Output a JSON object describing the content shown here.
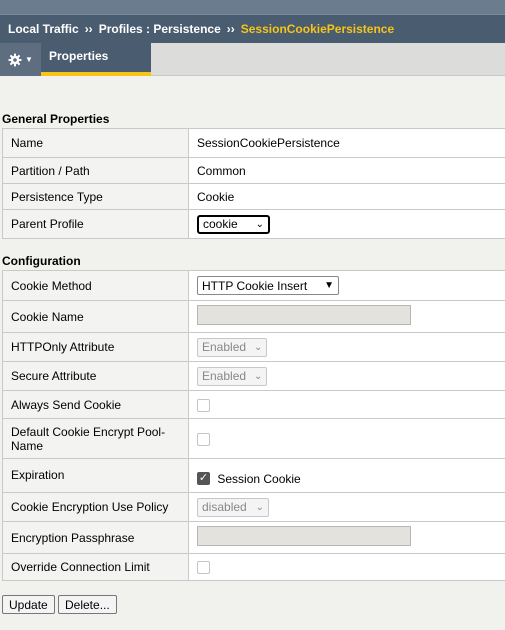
{
  "breadcrumb": {
    "items": [
      "Local Traffic",
      "Profiles : Persistence"
    ],
    "separator": "››",
    "current": "SessionCookiePersistence"
  },
  "tabs": {
    "properties": "Properties"
  },
  "general": {
    "title": "General Properties",
    "rows": [
      {
        "label": "Name",
        "value": "SessionCookiePersistence"
      },
      {
        "label": "Partition / Path",
        "value": "Common"
      },
      {
        "label": "Persistence Type",
        "value": "Cookie"
      },
      {
        "label": "Parent Profile",
        "select": "cookie"
      }
    ]
  },
  "configuration": {
    "title": "Configuration",
    "rows": [
      {
        "label": "Cookie Method",
        "select": "HTTP Cookie Insert"
      },
      {
        "label": "Cookie Name",
        "value": ""
      },
      {
        "label": "HTTPOnly Attribute",
        "select": "Enabled"
      },
      {
        "label": "Secure Attribute",
        "select": "Enabled"
      },
      {
        "label": "Always Send Cookie",
        "checked": false
      },
      {
        "label": "Default Cookie Encrypt Pool-Name",
        "checked": false
      },
      {
        "label": "Expiration",
        "checked": true,
        "checkbox_label": "Session Cookie"
      },
      {
        "label": "Cookie Encryption Use Policy",
        "select": "disabled"
      },
      {
        "label": "Encryption Passphrase",
        "value": ""
      },
      {
        "label": "Override Connection Limit",
        "checked": false
      }
    ]
  },
  "buttons": {
    "update": "Update",
    "delete": "Delete..."
  },
  "colors": {
    "header_bg": "#4a5c70",
    "accent": "#f5c518",
    "page_bg": "#f1f1ee"
  }
}
